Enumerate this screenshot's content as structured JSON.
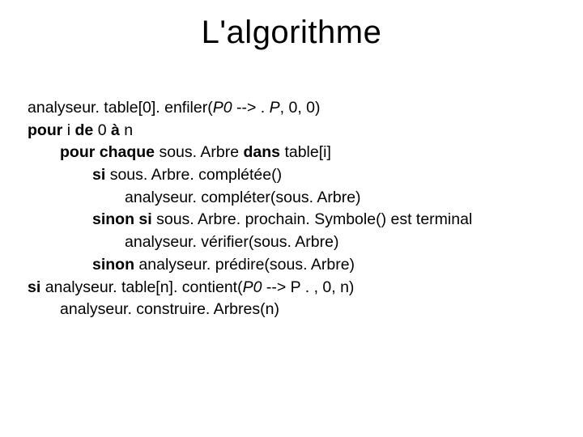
{
  "title": "L'algorithme",
  "algo": {
    "l1_a": "analyseur. table[0]. enfiler(",
    "l1_b": "P0 ",
    "l1_c": "--> . ",
    "l1_d": "P",
    "l1_e": ", 0, 0)",
    "l2_a": "pour ",
    "l2_b": "i ",
    "l2_c": "de ",
    "l2_d": "0 ",
    "l2_e": "à ",
    "l2_f": "n",
    "l3_a": "pour chaque ",
    "l3_b": "sous. Arbre ",
    "l3_c": "dans ",
    "l3_d": "table[i]",
    "l4_a": "si ",
    "l4_b": "sous. Arbre. complétée()",
    "l5": "analyseur. compléter(sous. Arbre)",
    "l6_a": "sinon si ",
    "l6_b": "sous. Arbre. prochain. Symbole() est terminal",
    "l7": "analyseur. vérifier(sous. Arbre)",
    "l8_a": "sinon ",
    "l8_b": "analyseur. prédire(sous. Arbre)",
    "l9_a": "si ",
    "l9_b": "analyseur. table[n]. contient(",
    "l9_c": "P0 ",
    "l9_d": "--> P . , 0, n)",
    "l10": "analyseur. construire. Arbres(n)"
  }
}
